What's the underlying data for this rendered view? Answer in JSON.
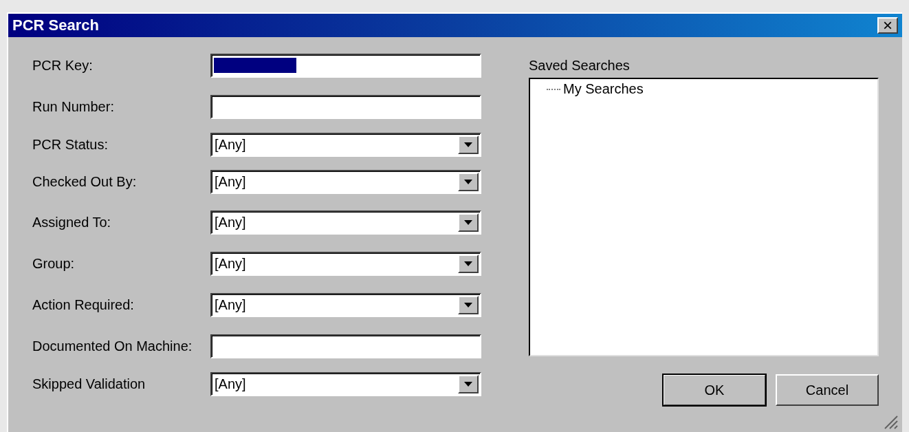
{
  "window": {
    "title": "PCR Search",
    "close": "×"
  },
  "fields": [
    {
      "label": "PCR Key:",
      "kind": "text",
      "value_selected": true
    },
    {
      "label": "Run Number:",
      "kind": "text",
      "value_selected": false
    },
    {
      "label": "PCR Status:",
      "kind": "dropdown",
      "value": "[Any]"
    },
    {
      "label": "Checked Out By:",
      "kind": "dropdown",
      "value": "[Any]"
    },
    {
      "label": "Assigned To:",
      "kind": "dropdown",
      "value": "[Any]"
    },
    {
      "label": "Group:",
      "kind": "dropdown",
      "value": "[Any]"
    },
    {
      "label": "Action Required:",
      "kind": "dropdown",
      "value": "[Any]"
    },
    {
      "label": "Documented On Machine:",
      "kind": "text",
      "value_selected": false
    },
    {
      "label": "Skipped Validation",
      "kind": "dropdown",
      "value": "[Any]"
    }
  ],
  "saved_searches": {
    "label": "Saved Searches",
    "tree": [
      {
        "label": "My Searches"
      }
    ]
  },
  "buttons": [
    {
      "label": "OK",
      "default": true
    },
    {
      "label": "Cancel",
      "default": false
    }
  ]
}
